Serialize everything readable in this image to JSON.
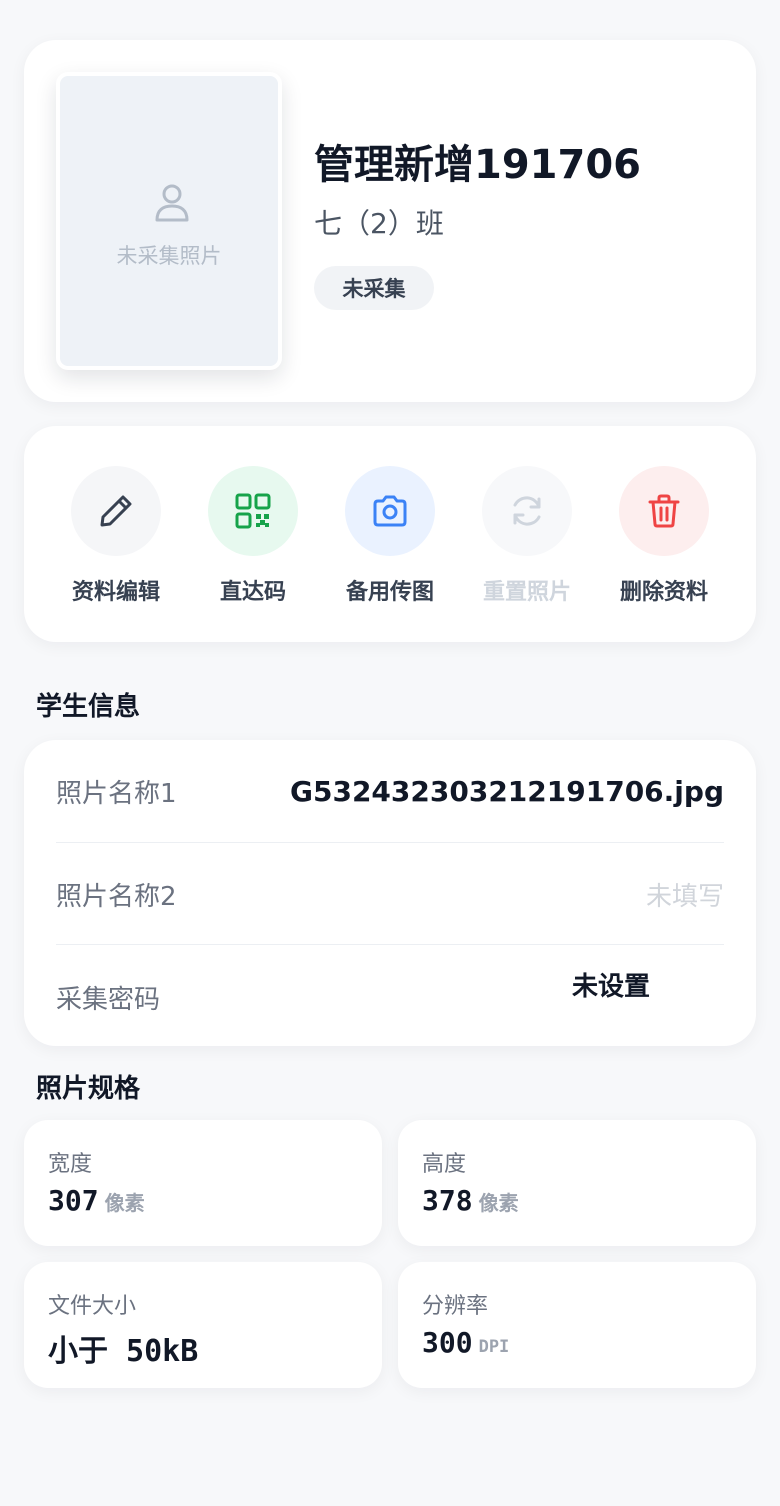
{
  "profile": {
    "photo_placeholder": "未采集照片",
    "name": "管理新增191706",
    "class_name": "七（2）班",
    "status": "未采集"
  },
  "actions": [
    {
      "label": "资料编辑",
      "icon": "pencil-icon",
      "bg": "#f5f6f8",
      "color": "#374151",
      "disabled": false
    },
    {
      "label": "直达码",
      "icon": "qr-code-icon",
      "bg": "#e7f9ef",
      "color": "#16a34a",
      "disabled": false
    },
    {
      "label": "备用传图",
      "icon": "camera-icon",
      "bg": "#eaf2ff",
      "color": "#3b82f6",
      "disabled": false
    },
    {
      "label": "重置照片",
      "icon": "refresh-icon",
      "bg": "#f7f8fa",
      "color": "#cfd5dd",
      "disabled": true
    },
    {
      "label": "删除资料",
      "icon": "trash-icon",
      "bg": "#fdeeee",
      "color": "#ef4444",
      "disabled": false
    }
  ],
  "student_info": {
    "title": "学生信息",
    "rows": [
      {
        "label": "照片名称1",
        "value": "G532432303212191706.jpg"
      },
      {
        "label": "照片名称2",
        "value": "未填写"
      },
      {
        "label": "采集密码",
        "value": "未设置"
      }
    ]
  },
  "photo_spec": {
    "title": "照片规格",
    "items": [
      {
        "label": "宽度",
        "value": "307",
        "unit": "像素"
      },
      {
        "label": "高度",
        "value": "378",
        "unit": "像素"
      },
      {
        "label": "文件大小",
        "value": "小于 50kB",
        "unit": ""
      },
      {
        "label": "分辨率",
        "value": "300",
        "unit": "DPI"
      }
    ]
  }
}
